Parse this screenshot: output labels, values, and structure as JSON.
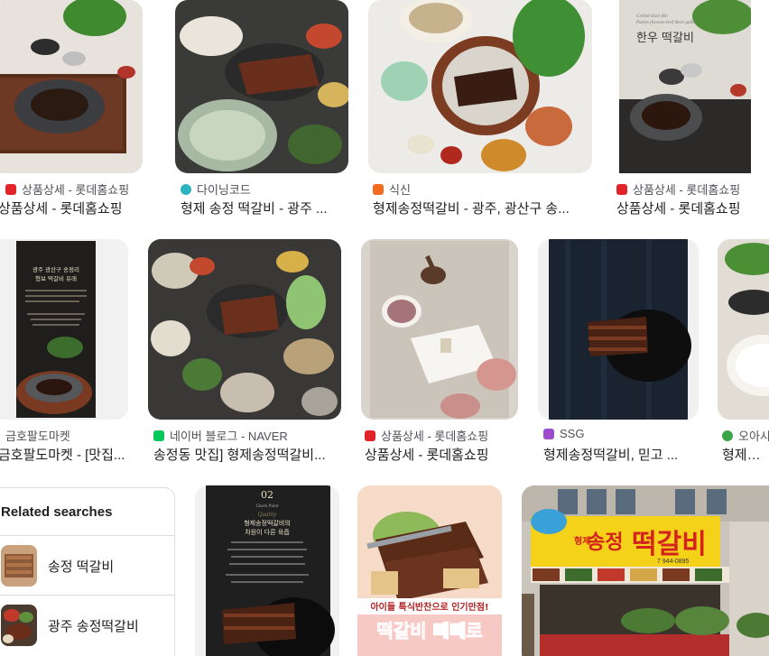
{
  "results": [
    {
      "source": "상품상세 - 롯데홈쇼핑",
      "title": "상품상세 - 롯데홈쇼핑",
      "favicon": "lotte-icon"
    },
    {
      "source": "다이닝코드",
      "title": "형제 송정 떡갈비 - 광주 ...",
      "favicon": "diningcode-icon"
    },
    {
      "source": "식신",
      "title": "형제송정떡갈비 - 광주, 광산구 송...",
      "favicon": "siksin-icon"
    },
    {
      "source": "상품상세 - 롯데홈쇼핑",
      "title": "상품상세 - 롯데홈쇼핑",
      "favicon": "lotte-icon"
    },
    {
      "source": "금호팔도마켓",
      "title": "금호팔도마켓 - [맛집...",
      "favicon": "market-icon"
    },
    {
      "source": "네이버 블로그 - NAVER",
      "title": "송정동 맛집] 형제송정떡갈비...",
      "favicon": "naver-blog-icon"
    },
    {
      "source": "상품상세 - 롯데홈쇼핑",
      "title": "상품상세 - 롯데홈쇼핑",
      "favicon": "lotte-icon"
    },
    {
      "source": "SSG",
      "title": "형제송정떡갈비, 믿고 ...",
      "favicon": "ssg-icon"
    },
    {
      "source": "오아시스",
      "title": "형제송정...",
      "favicon": "oasis-icon"
    }
  ],
  "image_text": {
    "r1c4_en1": "Grilled Short Rib",
    "r1c4_en2": "Patties (Korean beef Short galbi)",
    "r1c4_title": "한우 떡갈비",
    "r2c1_title": "광주 광산구 송정리",
    "r2c1_sub": "형보 떡갈비 유래",
    "r3c2_num": "02",
    "r3c2_en1": "Check Point",
    "r3c2_en2": "Quality",
    "r3c2_title1": "형제송정떡갈비의",
    "r3c2_title2": "차원이 다른 육즙",
    "r3c3_caption": "아이들 특식반찬으로 인기만점!",
    "r3c3_big": "떡갈비 빼빼로",
    "r3c4_sign_small": "형제",
    "r3c4_sign": "송정",
    "r3c4_sign_big": "떡갈비",
    "r3c4_phone": "7 944-0895"
  },
  "related": {
    "heading": "Related searches",
    "items": [
      {
        "label": "송정 떡갈비"
      },
      {
        "label": "광주 송정떡갈비"
      }
    ]
  },
  "colors": {
    "lotte": "#e0242a",
    "diningcode": "#2bb3c0",
    "siksin": "#f26b21",
    "naver": "#03c75a",
    "ssg": "#9c4dcc",
    "oasis": "#3ea44a",
    "sign_yellow": "#f5d21a",
    "sign_red": "#d4231c"
  }
}
